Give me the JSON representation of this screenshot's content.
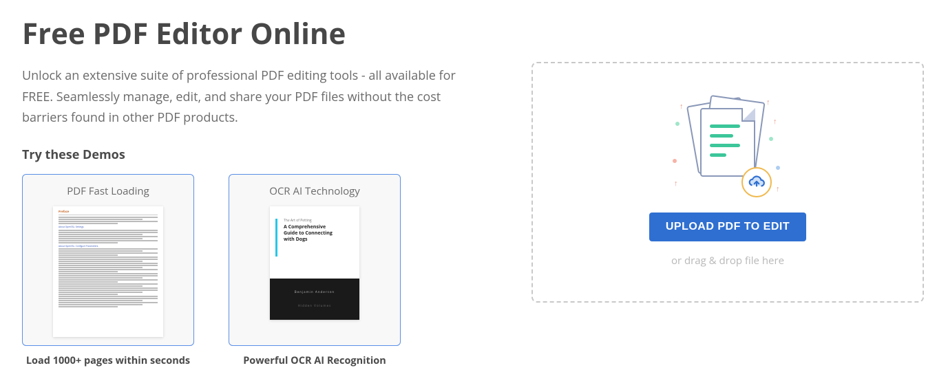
{
  "hero": {
    "title": "Free PDF Editor Online",
    "subtitle": "Unlock an extensive suite of professional PDF editing tools - all available for FREE. Seamlessly manage, edit, and share your PDF files without the cost barriers found in other PDF products."
  },
  "demos": {
    "heading": "Try these Demos",
    "items": [
      {
        "title": "PDF Fast Loading",
        "caption": "Load 1000+ pages within seconds",
        "preview": {
          "heading": "Preface",
          "section1": "About OpenSSL: Settings",
          "section2": "About OpenSSL: Configure Parameters"
        }
      },
      {
        "title": "OCR AI Technology",
        "caption": "Powerful OCR AI Recognition",
        "preview": {
          "kicker": "The Art of Petting",
          "headline": "A Comprehensive Guide to Connecting with Dogs",
          "author": "Benjamin Anderson",
          "publisher": "Hidden Volumes"
        }
      }
    ]
  },
  "dropzone": {
    "button_label": "UPLOAD PDF TO EDIT",
    "drag_text": "or drag & drop file here"
  }
}
